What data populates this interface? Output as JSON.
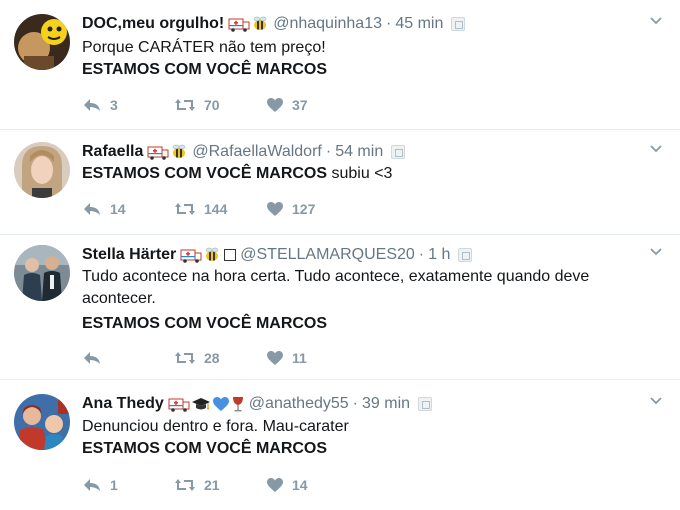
{
  "tweets": [
    {
      "name": "DOC,meu orgulho!",
      "handle": "@nhaquinha13",
      "time": "45 min",
      "lines": [
        "Porque CARÁTER não tem preço!"
      ],
      "bold": "ESTAMOS COM VOCÊ MARCOS",
      "bold_suffix": "",
      "replies": "3",
      "retweets": "70",
      "likes": "37",
      "emojis": [
        "ambulance-icon",
        "bee-icon"
      ]
    },
    {
      "name": "Rafaella",
      "handle": "@RafaellaWaldorf",
      "time": "54 min",
      "lines": [],
      "bold": "ESTAMOS COM VOCÊ MARCOS",
      "bold_suffix": " subiu <3",
      "replies": "14",
      "retweets": "144",
      "likes": "127",
      "emojis": [
        "ambulance-icon",
        "bee-icon"
      ]
    },
    {
      "name": "Stella Härter",
      "handle": "@STELLAMARQUES20",
      "time": "1 h",
      "lines": [
        "Tudo acontece na hora certa. Tudo acontece, exatamente quando deve",
        "acontecer."
      ],
      "bold": "ESTAMOS COM VOCÊ MARCOS",
      "bold_suffix": "",
      "replies": "",
      "retweets": "28",
      "likes": "11",
      "emojis": [
        "ambulance-icon",
        "bee-icon",
        "box-icon"
      ]
    },
    {
      "name": "Ana Thedy",
      "handle": "@anathedy55",
      "time": "39 min",
      "lines": [
        "Denunciou dentro e fora. Mau-carater"
      ],
      "bold": "ESTAMOS COM VOCÊ MARCOS",
      "bold_suffix": "",
      "replies": "1",
      "retweets": "21",
      "likes": "14",
      "emojis": [
        "ambulance-icon",
        "graduation-cap-icon",
        "blue-heart-icon",
        "wine-glass-icon"
      ]
    }
  ],
  "colors": {
    "secondary": "#657786",
    "action": "#8899a6",
    "divider": "#e6ecf0",
    "text": "#14171a"
  }
}
